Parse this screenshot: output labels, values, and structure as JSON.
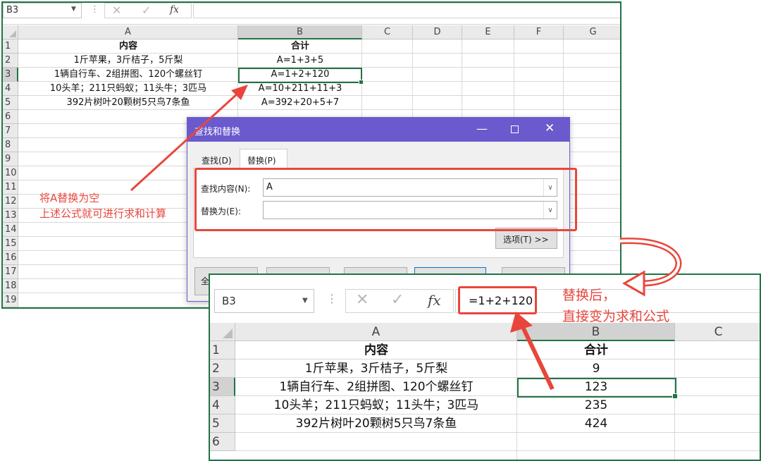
{
  "top_excel": {
    "name_box": "B3",
    "fx": "fx",
    "columns": [
      "A",
      "B",
      "C",
      "D",
      "E",
      "F",
      "G"
    ],
    "rows": [
      "1",
      "2",
      "3",
      "4",
      "5",
      "6",
      "7",
      "8",
      "9",
      "10",
      "11",
      "12",
      "13",
      "14",
      "15",
      "16",
      "17",
      "18",
      "19"
    ],
    "cells": [
      [
        "内容",
        "合计"
      ],
      [
        "1斤苹果，3斤桔子，5斤梨",
        "A=1+3+5"
      ],
      [
        "1辆自行车、2组拼图、120个螺丝钉",
        "A=1+2+120"
      ],
      [
        "10头羊；211只蚂蚁；11头牛；3匹马",
        "A=10+211+11+3"
      ],
      [
        "392片树叶20颗树5只鸟7条鱼",
        "A=392+20+5+7"
      ]
    ]
  },
  "dialog": {
    "title": "查找和替换",
    "tab_find": "查找(D)",
    "tab_replace": "替换(P)",
    "find_label": "查找内容(N):",
    "find_value": "A",
    "replace_label": "替换为(E):",
    "replace_value": "",
    "options_button": "选项(T) >>",
    "replace_all_partial": "全"
  },
  "annotation_left": [
    "将A替换为空",
    "上述公式就可进行求和计算"
  ],
  "annotation_right": [
    "替换后，",
    "直接变为求和公式"
  ],
  "bottom_excel": {
    "name_box": "B3",
    "fx": "fx",
    "formula": "=1+2+120",
    "columns": [
      "A",
      "B",
      "C"
    ],
    "rows": [
      "1",
      "2",
      "3",
      "4",
      "5",
      "6"
    ],
    "cells": [
      [
        "内容",
        "合计"
      ],
      [
        "1斤苹果，3斤桔子，5斤梨",
        "9"
      ],
      [
        "1辆自行车、2组拼图、120个螺丝钉",
        "123"
      ],
      [
        "10头羊；211只蚂蚁；11头牛；3匹马",
        "235"
      ],
      [
        "392片树叶20颗树5只鸟7条鱼",
        "424"
      ]
    ]
  },
  "colors": {
    "excel_green": "#217346",
    "annotation_red": "#e8463c",
    "dialog_title_bar": "#6a5acd",
    "header_bg": "#eaeaea",
    "selected_header_bg": "#d2d2d2"
  }
}
